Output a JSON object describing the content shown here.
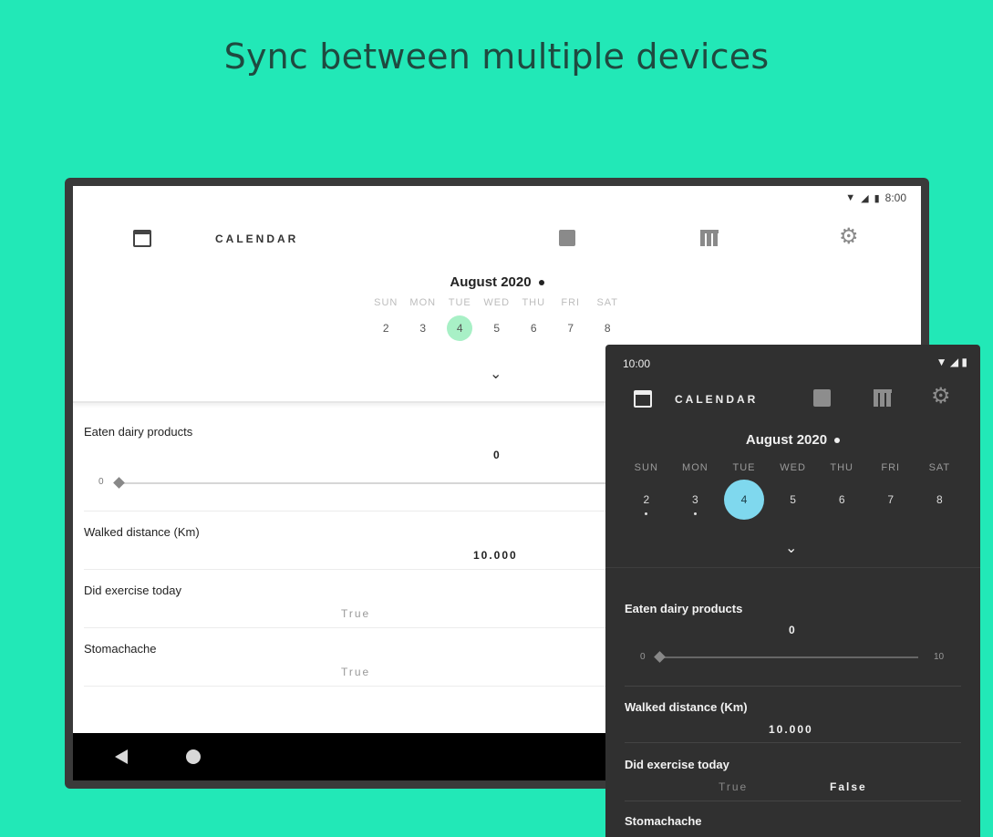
{
  "headline": "Sync between multiple devices",
  "tablet": {
    "status_time": "8:00",
    "toolbar_title": "CALENDAR",
    "month": "August 2020",
    "weekdays": [
      "SUN",
      "MON",
      "TUE",
      "WED",
      "THU",
      "FRI",
      "SAT"
    ],
    "dates": [
      "2",
      "3",
      "4",
      "5",
      "6",
      "7",
      "8"
    ],
    "selected_date": "4",
    "fields": [
      {
        "label": "Eaten dairy products",
        "value": "0",
        "slider_min": "0"
      },
      {
        "label": "Walked distance (Km)",
        "value": "10.000"
      },
      {
        "label": "Did exercise today",
        "value": "True"
      },
      {
        "label": "Stomachache",
        "value": "True"
      }
    ]
  },
  "phone": {
    "status_time": "10:00",
    "toolbar_title": "CALENDAR",
    "month": "August 2020",
    "weekdays": [
      "SUN",
      "MON",
      "TUE",
      "WED",
      "THU",
      "FRI",
      "SAT"
    ],
    "dates": [
      "2",
      "3",
      "4",
      "5",
      "6",
      "7",
      "8"
    ],
    "selected_date": "4",
    "fields": [
      {
        "label": "Eaten dairy products",
        "value": "0",
        "slider_min": "0",
        "slider_max": "10"
      },
      {
        "label": "Walked distance (Km)",
        "value": "10.000"
      },
      {
        "label": "Did exercise today",
        "option_true": "True",
        "option_false": "False"
      },
      {
        "label": "Stomachache"
      }
    ]
  },
  "colors": {
    "background": "#22e8b7",
    "selected_light": "#a8f0c6",
    "selected_dark": "#7fd8ee"
  }
}
